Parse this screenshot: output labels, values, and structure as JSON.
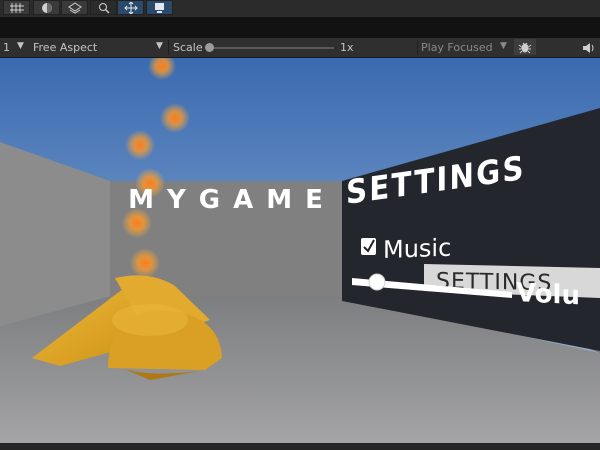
{
  "toolbar": {
    "icons": [
      "grid-icon",
      "sphere-icon",
      "layers-icon",
      "search-icon",
      "move-icon",
      "screen-icon"
    ]
  },
  "game_bar": {
    "display_number": "1",
    "aspect": "Free Aspect",
    "scale_label": "Scale",
    "scale_value": "1x",
    "play_focused": "Play Focused",
    "scale_slider_value": 0.0
  },
  "scene": {
    "title_text": "MYGAME",
    "settings_heading": "SETTINGS",
    "music_label": "Music",
    "music_checked": true,
    "settings_button": "SETTINGS",
    "volume_label": "Volu",
    "volume_slider_value": 0.1
  },
  "colors": {
    "sky": "#3f6fb3",
    "floor": "#8e8e90",
    "panel": "#23262c",
    "gold": "#e0a528",
    "fire": "#f08a1c"
  }
}
